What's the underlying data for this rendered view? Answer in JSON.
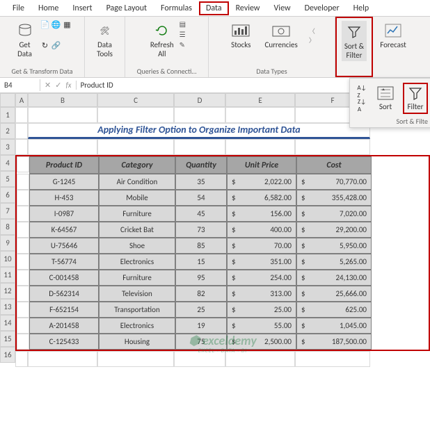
{
  "tabs": {
    "file": "File",
    "home": "Home",
    "insert": "Insert",
    "page_layout": "Page Layout",
    "formulas": "Formulas",
    "data": "Data",
    "review": "Review",
    "view": "View",
    "developer": "Developer",
    "help": "Help"
  },
  "ribbon": {
    "get_data": "Get\nData",
    "data_tools": "Data\nTools",
    "refresh_all": "Refresh\nAll",
    "stocks": "Stocks",
    "currencies": "Currencies",
    "sort_filter": "Sort &\nFilter",
    "forecast": "Forecast",
    "group_get_transform": "Get & Transform Data",
    "group_queries": "Queries & Connecti…",
    "group_data_types": "Data Types"
  },
  "dropdown": {
    "sort": "Sort",
    "filter": "Filter",
    "panel_label": "Sort & Filte"
  },
  "name_box": "B4",
  "fx": "fx",
  "formula_value": "Product ID",
  "cols": [
    "A",
    "B",
    "C",
    "D",
    "E",
    "F"
  ],
  "rows": [
    "1",
    "2",
    "3",
    "4",
    "5",
    "6",
    "7",
    "8",
    "9",
    "10",
    "11",
    "12",
    "13",
    "14",
    "15",
    "16"
  ],
  "title": "Applying Filter Option to Organize Important Data",
  "headers": {
    "pid": "Product ID",
    "cat": "Category",
    "qty": "Quantity",
    "price": "Unit Price",
    "cost": "Cost"
  },
  "currency": "$",
  "data": [
    {
      "pid": "G-1245",
      "cat": "Air Condition",
      "qty": "35",
      "price": "2,022.00",
      "cost": "70,770.00"
    },
    {
      "pid": "H-453",
      "cat": "Mobile",
      "qty": "54",
      "price": "6,582.00",
      "cost": "355,428.00"
    },
    {
      "pid": "I-0987",
      "cat": "Furniture",
      "qty": "45",
      "price": "156.00",
      "cost": "7,020.00"
    },
    {
      "pid": "K-64567",
      "cat": "Cricket Bat",
      "qty": "73",
      "price": "400.00",
      "cost": "29,200.00"
    },
    {
      "pid": "U-75646",
      "cat": "Shoe",
      "qty": "85",
      "price": "70.00",
      "cost": "5,950.00"
    },
    {
      "pid": "T-56774",
      "cat": "Electronics",
      "qty": "15",
      "price": "351.00",
      "cost": "5,265.00"
    },
    {
      "pid": "C-001458",
      "cat": "Furniture",
      "qty": "95",
      "price": "254.00",
      "cost": "24,130.00"
    },
    {
      "pid": "D-562314",
      "cat": "Television",
      "qty": "82",
      "price": "313.00",
      "cost": "25,666.00"
    },
    {
      "pid": "F-652154",
      "cat": "Transportation",
      "qty": "25",
      "price": "25.00",
      "cost": "625.00"
    },
    {
      "pid": "A-201458",
      "cat": "Electronics",
      "qty": "19",
      "price": "55.00",
      "cost": "1,045.00"
    },
    {
      "pid": "C-125433",
      "cat": "Housing",
      "qty": "75",
      "price": "2,500.00",
      "cost": "187,500.00"
    }
  ],
  "watermark": {
    "line1": "exceldemy",
    "line2": "EXCEL · DATA · BI"
  },
  "chart_data": {
    "type": "table",
    "title": "Applying Filter Option to Organize Important Data",
    "columns": [
      "Product ID",
      "Category",
      "Quantity",
      "Unit Price",
      "Cost"
    ],
    "rows": [
      [
        "G-1245",
        "Air Condition",
        35,
        2022.0,
        70770.0
      ],
      [
        "H-453",
        "Mobile",
        54,
        6582.0,
        355428.0
      ],
      [
        "I-0987",
        "Furniture",
        45,
        156.0,
        7020.0
      ],
      [
        "K-64567",
        "Cricket Bat",
        73,
        400.0,
        29200.0
      ],
      [
        "U-75646",
        "Shoe",
        85,
        70.0,
        5950.0
      ],
      [
        "T-56774",
        "Electronics",
        15,
        351.0,
        5265.0
      ],
      [
        "C-001458",
        "Furniture",
        95,
        254.0,
        24130.0
      ],
      [
        "D-562314",
        "Television",
        82,
        313.0,
        25666.0
      ],
      [
        "F-652154",
        "Transportation",
        25,
        25.0,
        625.0
      ],
      [
        "A-201458",
        "Electronics",
        19,
        55.0,
        1045.0
      ],
      [
        "C-125433",
        "Housing",
        75,
        2500.0,
        187500.0
      ]
    ]
  }
}
